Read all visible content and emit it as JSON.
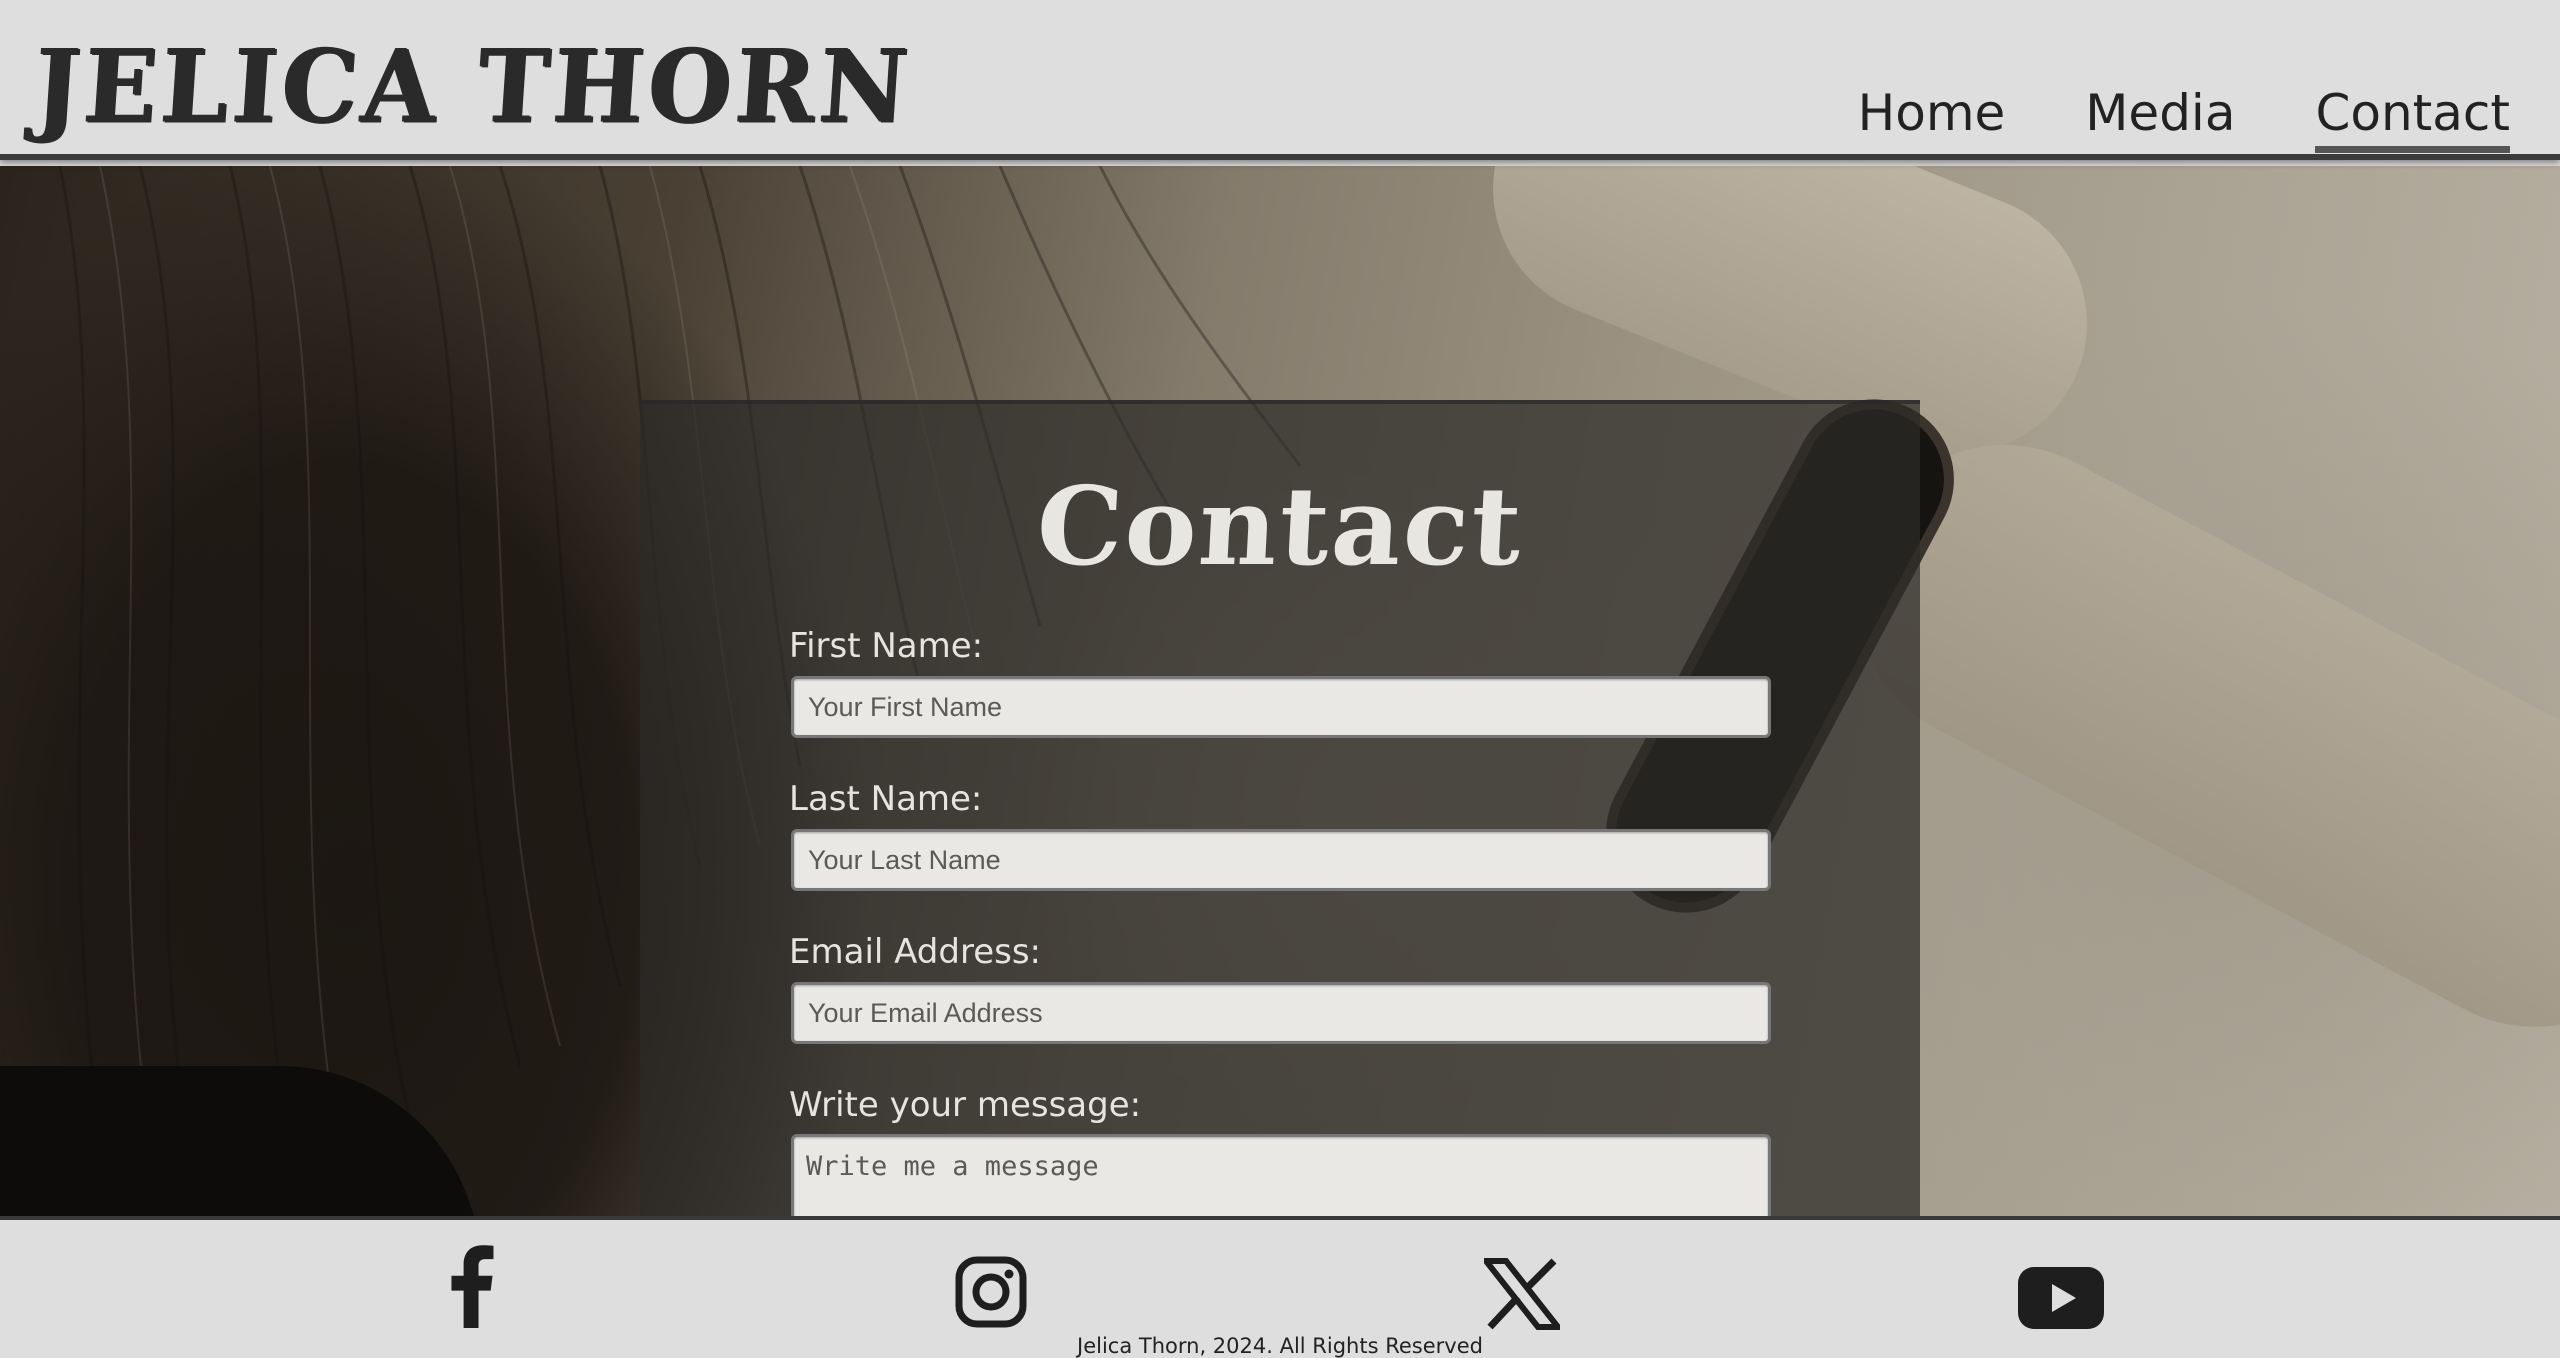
{
  "header": {
    "logo": "JELICA THORN",
    "nav": [
      {
        "label": "Home",
        "active": false
      },
      {
        "label": "Media",
        "active": false
      },
      {
        "label": "Contact",
        "active": true
      }
    ]
  },
  "form": {
    "title": "Contact",
    "first_name": {
      "label": "First Name:",
      "placeholder": "Your First Name"
    },
    "last_name": {
      "label": "Last Name:",
      "placeholder": "Your Last Name"
    },
    "email": {
      "label": "Email Address:",
      "placeholder": "Your Email Address"
    },
    "message": {
      "label": "Write your message:",
      "placeholder": "Write me a message"
    }
  },
  "footer": {
    "social": [
      "facebook-icon",
      "instagram-icon",
      "x-icon",
      "youtube-icon"
    ],
    "copyright": "Jelica Thorn, 2024. All Rights Reserved"
  },
  "colors": {
    "header_bg": "#dedede",
    "panel_bg": "#2d2b28",
    "text_light": "#e6e4df",
    "text_dark": "#222222"
  }
}
